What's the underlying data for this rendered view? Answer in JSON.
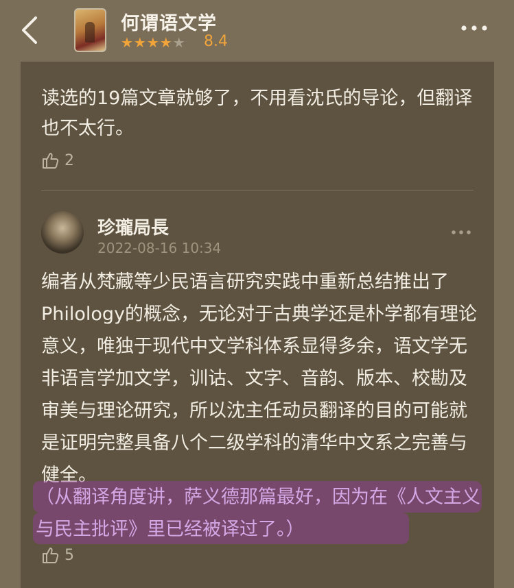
{
  "header": {
    "back_icon": "chevron-left-icon",
    "book_title": "何谓语文学",
    "rating_stars_filled": "★★★★",
    "rating_stars_empty": "★",
    "rating_score": "8.4",
    "rating_value": 4,
    "more_icon": "more-horizontal-icon",
    "colors": {
      "accent": "#f0a43a",
      "background": "#7a6e58",
      "card": "#5e5340"
    }
  },
  "previous_review": {
    "text": "读选的19篇文章就够了，不用看沈氏的导论，但翻译也不太行。",
    "like_count": "2"
  },
  "review": {
    "username": "珍瓏局長",
    "timestamp": "2022-08-16 10:34",
    "body": "编者从梵藏等少民语言研究实践中重新总结推出了Philology的概念，无论对于古典学还是朴学都有理论意义，唯独于现代中文学科体系显得多余，语文学无非语言学加文学，训诂、文字、音韵、版本、校勘及审美与理论研究，所以沈主任动员翻译的目的可能就是证明完整具备八个二级学科的清华中文系之完善与健全。",
    "highlighted": "（从翻译角度讲，萨义德那篇最好，因为在《人文主义与民主批评》里已经被译过了。）",
    "like_count": "5"
  }
}
